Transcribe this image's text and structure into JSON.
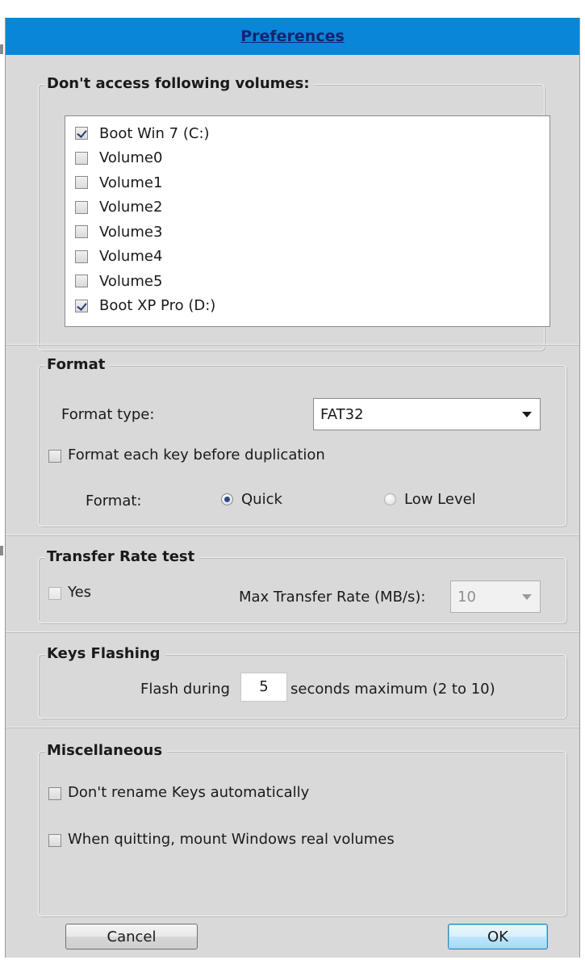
{
  "window": {
    "title": "Preferences"
  },
  "volumes": {
    "legend": "Don't access following volumes:",
    "items": [
      {
        "label": "Boot Win 7 (C:)",
        "checked": true
      },
      {
        "label": "Volume0",
        "checked": false
      },
      {
        "label": "Volume1",
        "checked": false
      },
      {
        "label": "Volume2",
        "checked": false
      },
      {
        "label": "Volume3",
        "checked": false
      },
      {
        "label": "Volume4",
        "checked": false
      },
      {
        "label": "Volume5",
        "checked": false
      },
      {
        "label": "Boot XP Pro (D:)",
        "checked": true
      }
    ]
  },
  "format": {
    "legend": "Format",
    "type_label": "Format type:",
    "type_value": "FAT32",
    "each_key_label": "Format each key before duplication",
    "each_key_checked": false,
    "mode_label": "Format:",
    "options": [
      {
        "label": "Quick",
        "selected": true
      },
      {
        "label": "Low Level",
        "selected": false
      }
    ]
  },
  "transfer": {
    "legend": "Transfer Rate test",
    "yes_label": "Yes",
    "yes_checked": false,
    "max_label": "Max Transfer Rate (MB/s):",
    "max_value": "10"
  },
  "flashing": {
    "legend": "Keys Flashing",
    "prefix": "Flash during",
    "seconds_value": "5",
    "suffix": "seconds maximum (2 to 10)"
  },
  "misc": {
    "legend": "Miscellaneous",
    "items": [
      {
        "label": "Don't rename Keys automatically",
        "checked": false
      },
      {
        "label": "When quitting, mount Windows real volumes",
        "checked": false
      }
    ]
  },
  "buttons": {
    "cancel": "Cancel",
    "ok": "OK"
  },
  "colors": {
    "titlebar": "#0a86d8",
    "title_text": "#13246e",
    "dialog_bg": "#d9d9d9"
  }
}
